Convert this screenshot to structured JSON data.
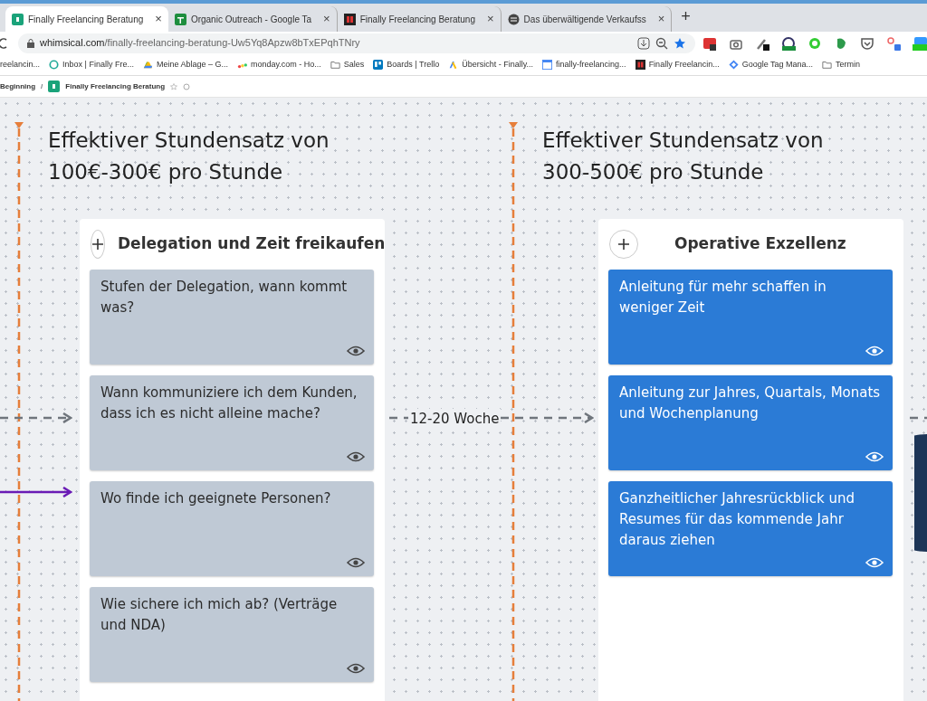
{
  "tabs": [
    {
      "title": "Finally Freelancing Beratung",
      "close": "×",
      "selected": true
    },
    {
      "title": "Organic Outreach - Google Ta",
      "close": "×",
      "selected": false
    },
    {
      "title": "Finally Freelancing Beratung",
      "close": "×",
      "selected": false
    },
    {
      "title": "Das überwältigende Verkaufss",
      "close": "×",
      "selected": false
    }
  ],
  "new_tab": "+",
  "address": {
    "host": "whimsical.com",
    "path": "/finally-freelancing-beratung-Uw5Yq8Apzw8bTxEPqhTNry"
  },
  "bookmarks": [
    "reelancin...",
    "Inbox | Finally Fre...",
    "Meine Ablage – G...",
    "monday.com - Ho...",
    "Sales",
    "Boards | Trello",
    "Übersicht - Finally...",
    "finally-freelancing...",
    "Finally Freelancin...",
    "Google Tag Mana...",
    "Termin"
  ],
  "breadcrumb": [
    "Beginning",
    "Finally Freelancing Beratung"
  ],
  "breadcrumb_separator": "/",
  "board": {
    "headings": [
      "Effektiver Stundensatz von\n100€-300€ pro Stunde",
      "Effektiver Stundensatz von\n300-500€ pro Stunde"
    ],
    "columns": [
      {
        "title": "Delegation und Zeit freikaufen",
        "color": "#bfc9d5",
        "cards": [
          {
            "text": "Stufen der Delegation, wann kommt was?"
          },
          {
            "text": "Wann kommuniziere ich dem Kunden, dass ich es nicht alleine mache?"
          },
          {
            "text": "Wo finde ich geeignete Personen?"
          },
          {
            "text": "Wie sichere ich mich ab? (Verträge und NDA)"
          }
        ]
      },
      {
        "title": "Operative Exzellenz",
        "color": "#2b7bd6",
        "cards": [
          {
            "text": "Anleitung für mehr schaffen in weniger Zeit"
          },
          {
            "text": "Anleitung zur Jahres, Quartals, Monats und Wochenplanung"
          },
          {
            "text": "Ganzheitlicher Jahresrückblick und Resumes für das kommende Jahr daraus ziehen"
          }
        ]
      }
    ],
    "connector_label": "12-20 Woche"
  }
}
